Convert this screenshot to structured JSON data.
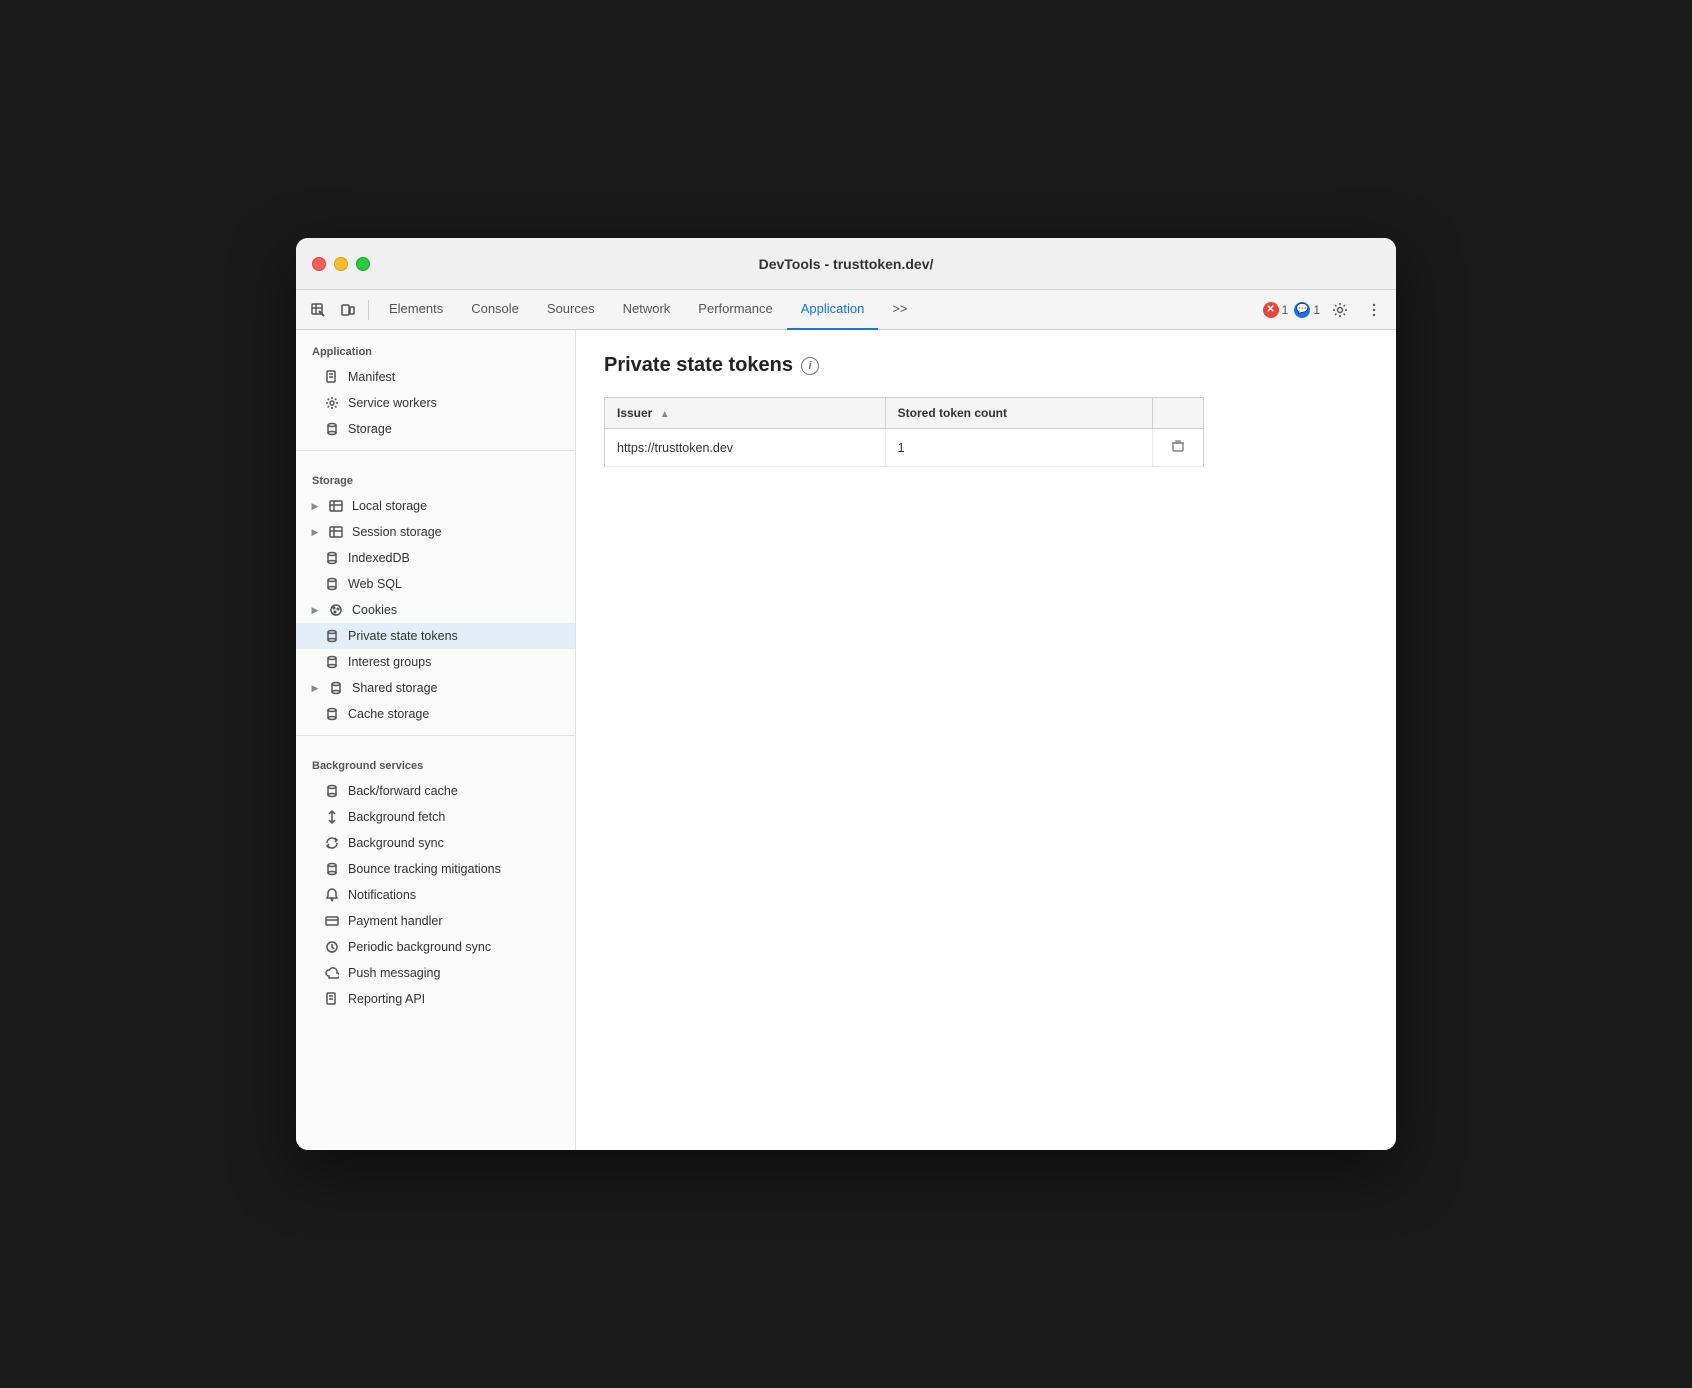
{
  "window": {
    "title": "DevTools - trusttoken.dev/"
  },
  "toolbar": {
    "tabs": [
      {
        "label": "Elements",
        "active": false
      },
      {
        "label": "Console",
        "active": false
      },
      {
        "label": "Sources",
        "active": false
      },
      {
        "label": "Network",
        "active": false
      },
      {
        "label": "Performance",
        "active": false
      },
      {
        "label": "Application",
        "active": true
      },
      {
        "label": ">>",
        "active": false
      }
    ],
    "error_count": "1",
    "warning_count": "1"
  },
  "sidebar": {
    "sections": [
      {
        "header": "Application",
        "items": [
          {
            "label": "Manifest",
            "icon": "file",
            "active": false,
            "indent": 1
          },
          {
            "label": "Service workers",
            "icon": "gear",
            "active": false,
            "indent": 1
          },
          {
            "label": "Storage",
            "icon": "cylinder",
            "active": false,
            "indent": 1
          }
        ]
      },
      {
        "header": "Storage",
        "items": [
          {
            "label": "Local storage",
            "icon": "table",
            "active": false,
            "indent": 1,
            "hasArrow": true
          },
          {
            "label": "Session storage",
            "icon": "table",
            "active": false,
            "indent": 1,
            "hasArrow": true
          },
          {
            "label": "IndexedDB",
            "icon": "cylinder",
            "active": false,
            "indent": 1
          },
          {
            "label": "Web SQL",
            "icon": "cylinder",
            "active": false,
            "indent": 1
          },
          {
            "label": "Cookies",
            "icon": "cookie",
            "active": false,
            "indent": 1,
            "hasArrow": true
          },
          {
            "label": "Private state tokens",
            "icon": "cylinder",
            "active": true,
            "indent": 1
          },
          {
            "label": "Interest groups",
            "icon": "cylinder",
            "active": false,
            "indent": 1
          },
          {
            "label": "Shared storage",
            "icon": "cylinder",
            "active": false,
            "indent": 1,
            "hasArrow": true
          },
          {
            "label": "Cache storage",
            "icon": "cylinder",
            "active": false,
            "indent": 1
          }
        ]
      },
      {
        "header": "Background services",
        "items": [
          {
            "label": "Back/forward cache",
            "icon": "cylinder",
            "active": false,
            "indent": 1
          },
          {
            "label": "Background fetch",
            "icon": "arrows-updown",
            "active": false,
            "indent": 1
          },
          {
            "label": "Background sync",
            "icon": "sync",
            "active": false,
            "indent": 1
          },
          {
            "label": "Bounce tracking mitigations",
            "icon": "cylinder",
            "active": false,
            "indent": 1
          },
          {
            "label": "Notifications",
            "icon": "bell",
            "active": false,
            "indent": 1
          },
          {
            "label": "Payment handler",
            "icon": "card",
            "active": false,
            "indent": 1
          },
          {
            "label": "Periodic background sync",
            "icon": "clock",
            "active": false,
            "indent": 1
          },
          {
            "label": "Push messaging",
            "icon": "cloud",
            "active": false,
            "indent": 1
          },
          {
            "label": "Reporting API",
            "icon": "file",
            "active": false,
            "indent": 1
          }
        ]
      }
    ]
  },
  "content": {
    "title": "Private state tokens",
    "table": {
      "columns": [
        {
          "label": "Issuer",
          "sortable": true
        },
        {
          "label": "Stored token count",
          "sortable": false
        },
        {
          "label": "",
          "sortable": false
        }
      ],
      "rows": [
        {
          "issuer": "https://trusttoken.dev",
          "count": "1"
        }
      ]
    }
  }
}
